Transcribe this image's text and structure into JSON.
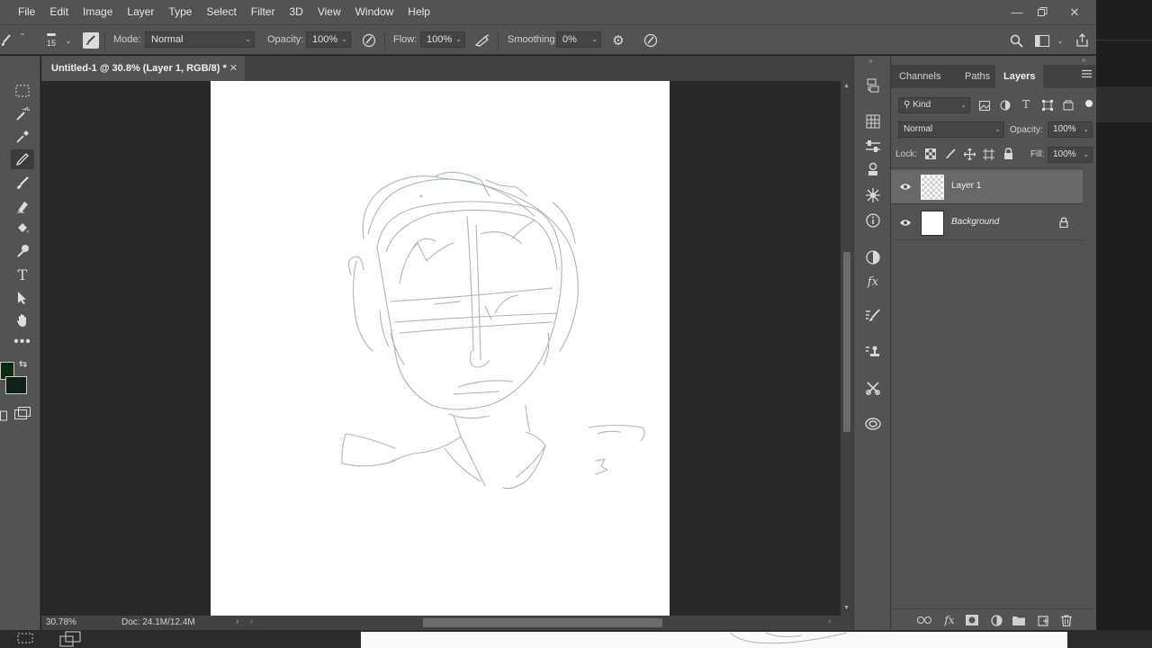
{
  "app": {
    "menu": [
      "File",
      "Edit",
      "Image",
      "Layer",
      "Type",
      "Select",
      "Filter",
      "3D",
      "View",
      "Window",
      "Help"
    ],
    "window_controls": [
      "minimize-icon",
      "restore-icon",
      "close-icon"
    ]
  },
  "options_bar": {
    "brush_size": "15",
    "mode_label": "Mode:",
    "mode_value": "Normal",
    "opacity_label": "Opacity:",
    "opacity_value": "100%",
    "flow_label": "Flow:",
    "flow_value": "100%",
    "smoothing_label": "Smoothing:",
    "smoothing_value": "0%"
  },
  "document": {
    "tab_title": "Untitled-1 @ 30.8% (Layer 1, RGB/8) *",
    "close_glyph": "✕",
    "zoom": "30.78%",
    "doc_info": "Doc: 24.1M/12.4M",
    "status_arrow": "›"
  },
  "colors": {
    "foreground": "#0b2a12",
    "background": "#0f1e19",
    "sketch_stroke": "#a9b8b0"
  },
  "layers_panel": {
    "tabs": [
      "Channels",
      "Paths",
      "Layers"
    ],
    "active_tab": "Layers",
    "filter_kind": "Kind",
    "blend_mode": "Normal",
    "opacity_label": "Opacity:",
    "opacity_value": "100%",
    "lock_label": "Lock:",
    "fill_label": "Fill:",
    "fill_value": "100%",
    "layers": [
      {
        "name": "Layer 1",
        "visible": true,
        "selected": true,
        "locked": false
      },
      {
        "name": "Background",
        "visible": true,
        "selected": false,
        "locked": true
      }
    ]
  }
}
